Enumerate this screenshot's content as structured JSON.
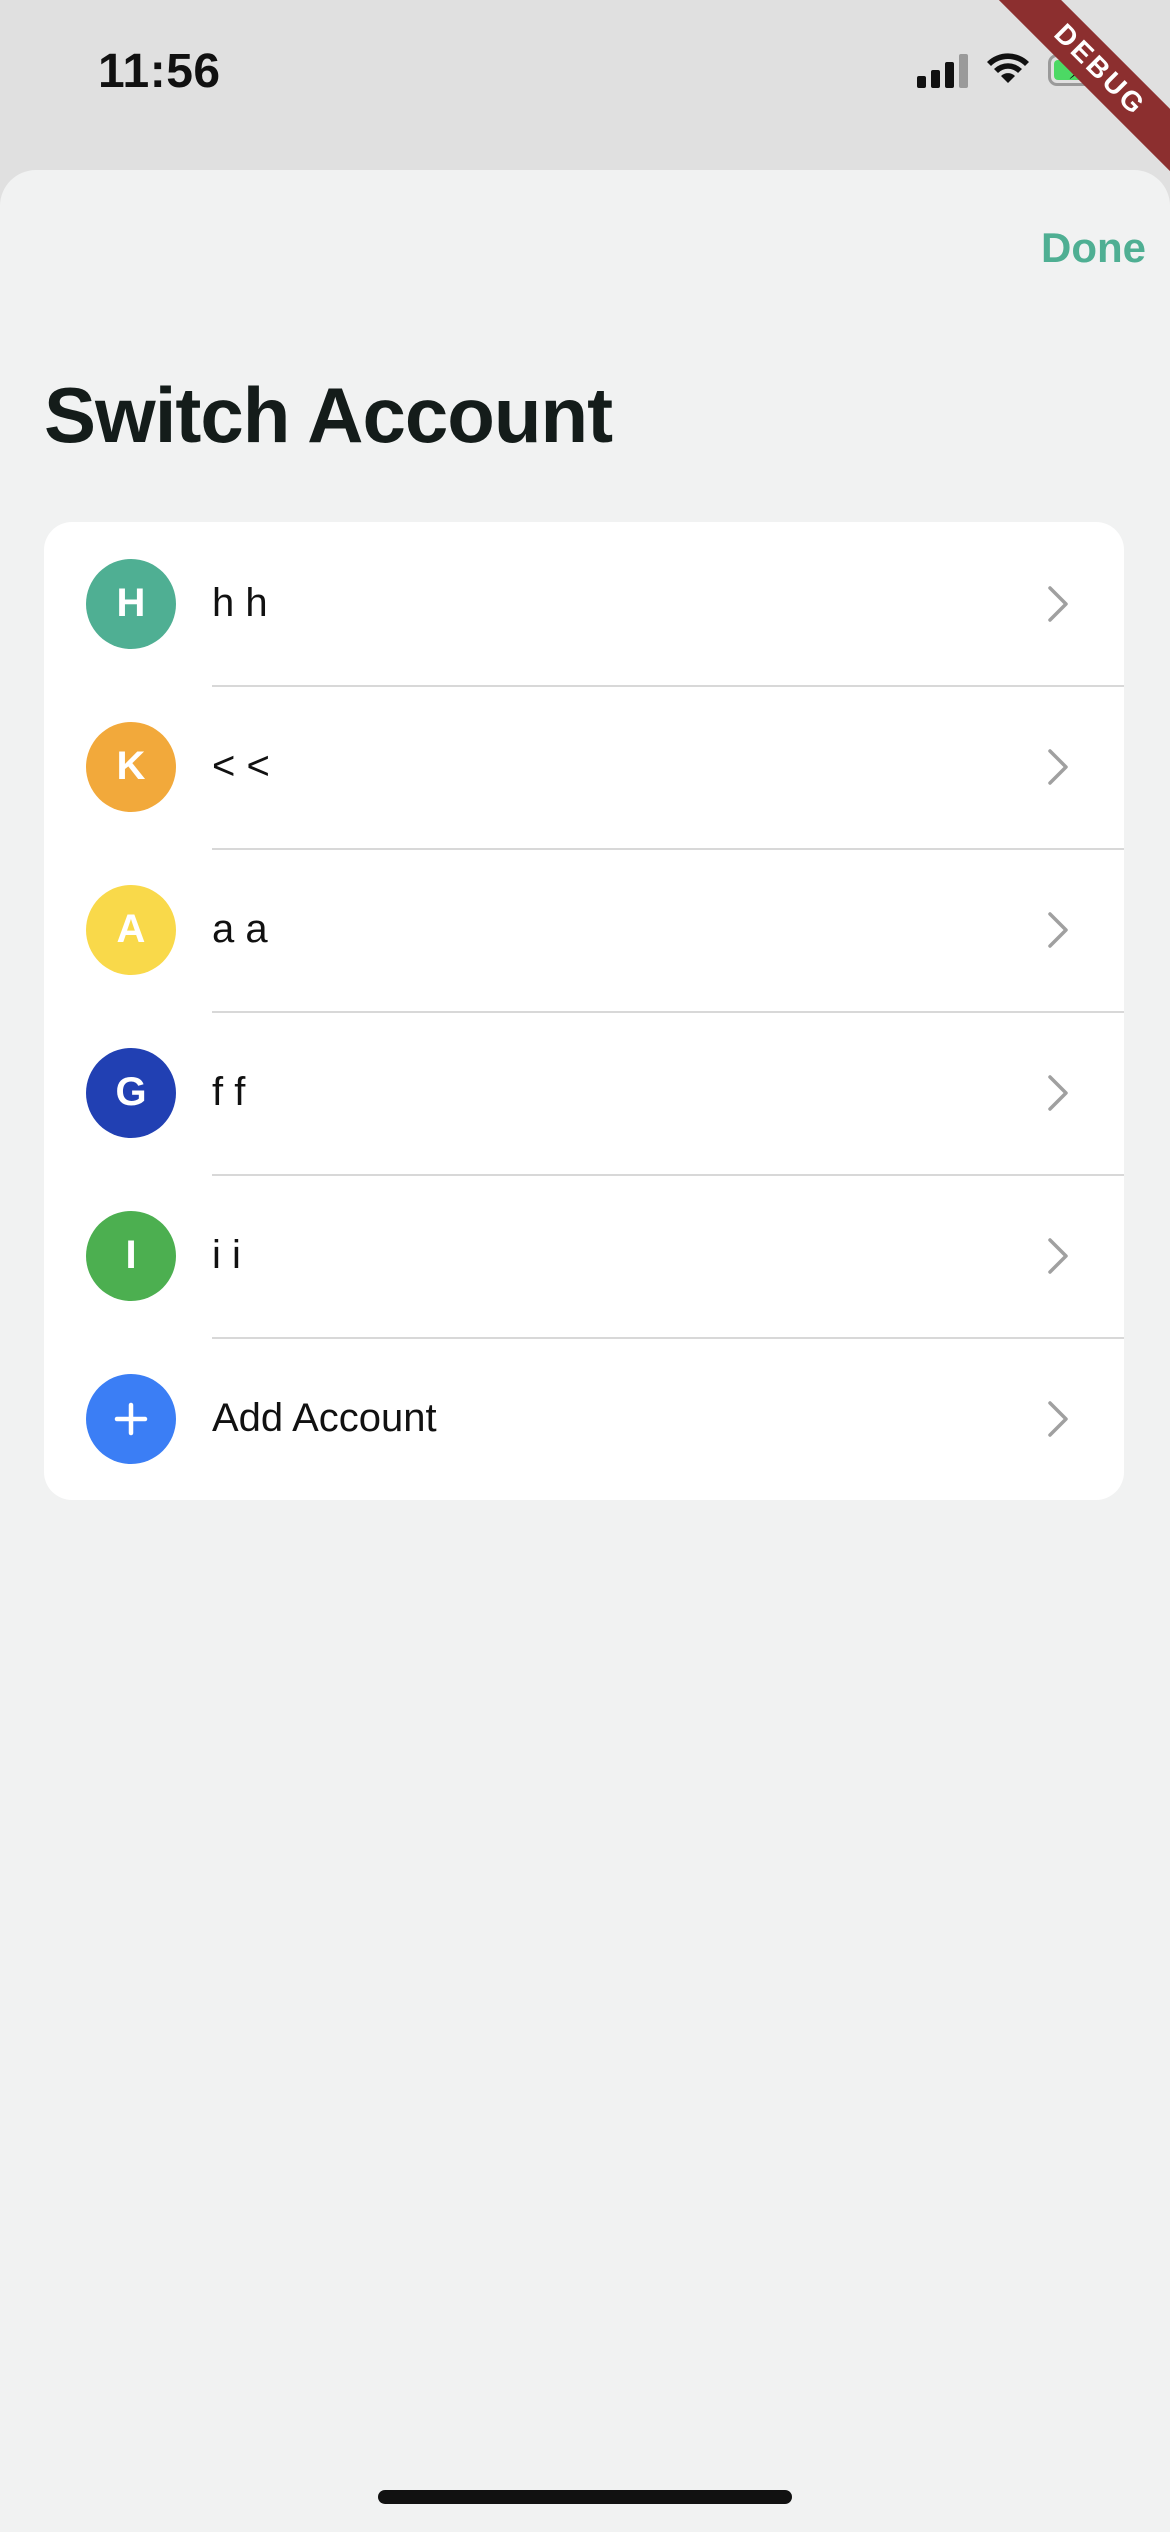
{
  "status_bar": {
    "time": "11:56"
  },
  "debug_banner": {
    "label": "DEBUG"
  },
  "sheet": {
    "done_label": "Done",
    "title": "Switch Account"
  },
  "accounts": [
    {
      "initial": "H",
      "name": "h h",
      "color": "#4faf93"
    },
    {
      "initial": "K",
      "name": "< <",
      "color": "#f2a93b"
    },
    {
      "initial": "A",
      "name": "a a",
      "color": "#f9d94a"
    },
    {
      "initial": "G",
      "name": "f f",
      "color": "#2140b3"
    },
    {
      "initial": "I",
      "name": "i i",
      "color": "#4caf50"
    }
  ],
  "add_account": {
    "icon": "plus-icon",
    "label": "Add Account",
    "color": "#3b7ef5"
  },
  "colors": {
    "accent": "#4faf93",
    "chevron": "#a0a0a0"
  }
}
